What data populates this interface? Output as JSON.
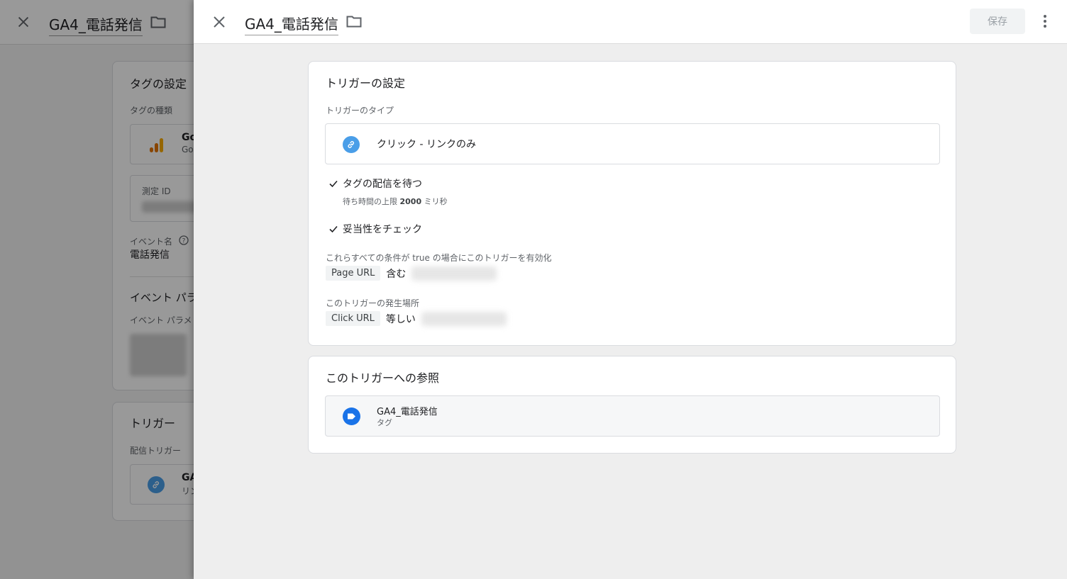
{
  "background_editor": {
    "title": "GA4_電話発信",
    "tag_config_heading": "タグの設定",
    "tag_type_label": "タグの種類",
    "tag_type_name": "Go",
    "tag_type_sub": "Goo",
    "measurement_id_label": "測定 ID",
    "event_name_label": "イベント名",
    "event_name_value": "電話発信",
    "event_params_heading": "イベント パラ",
    "event_params_label": "イベント パラメ",
    "triggers_heading": "トリガー",
    "firing_triggers_label": "配信トリガー",
    "trigger_item_name": "GA",
    "trigger_item_sub": "リン"
  },
  "panel": {
    "title": "GA4_電話発信",
    "save_label": "保存"
  },
  "trigger_settings": {
    "heading": "トリガーの設定",
    "type_label": "トリガーのタイプ",
    "type_value": "クリック - リンクのみ",
    "wait_for_tags_label": "タグの配信を待つ",
    "wait_prefix": "待ち時間の上限",
    "wait_value": "2000",
    "wait_suffix": "ミリ秒",
    "check_validation_label": "妥当性をチェック",
    "enable_conditions_label": "これらすべての条件が true の場合にこのトリガーを有効化",
    "enable_condition": {
      "variable": "Page URL",
      "operator": "含む"
    },
    "fire_on_label": "このトリガーの発生場所",
    "fire_condition": {
      "variable": "Click URL",
      "operator": "等しい"
    }
  },
  "references": {
    "heading": "このトリガーへの参照",
    "items": [
      {
        "name": "GA4_電話発信",
        "type": "タグ"
      }
    ]
  },
  "colors": {
    "link_icon_bg": "#4a9ee8",
    "tag_icon_bg": "#1a73e8",
    "analytics_orange": "#e37400"
  },
  "icons": {
    "close": "close-icon",
    "folder": "folder-icon",
    "more": "more-vert-icon",
    "link": "link-icon",
    "tag": "tag-icon",
    "check": "check-icon",
    "help": "help-icon"
  }
}
